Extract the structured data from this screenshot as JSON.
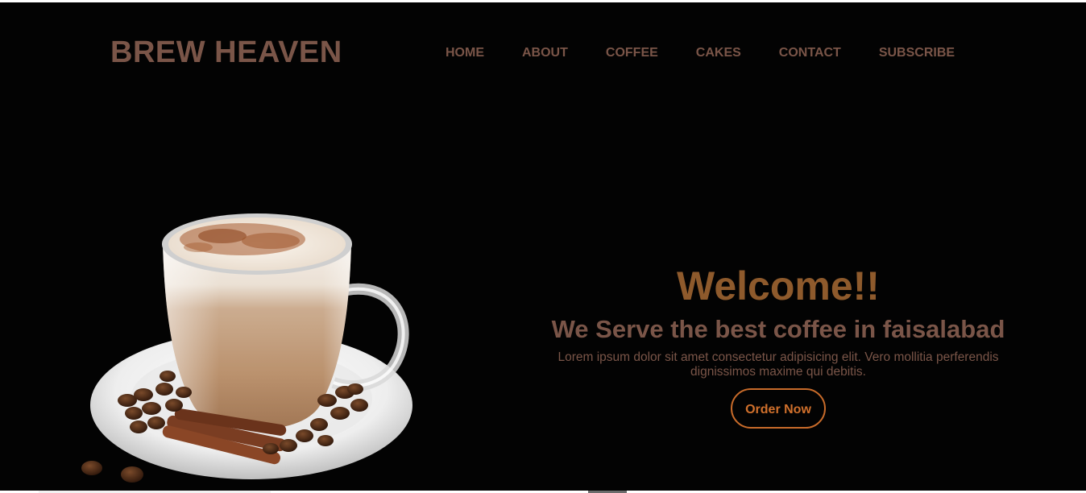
{
  "brand": {
    "name": "BREW HEAVEN"
  },
  "nav": {
    "items": [
      {
        "label": "HOME"
      },
      {
        "label": "ABOUT"
      },
      {
        "label": "COFFEE"
      },
      {
        "label": "CAKES"
      },
      {
        "label": "CONTACT"
      },
      {
        "label": "SUBSCRIBE"
      }
    ]
  },
  "hero": {
    "title": "Welcome!!",
    "subtitle": "We Serve the best coffee in faisalabad",
    "description": "Lorem ipsum dolor sit amet consectetur adipisicing elit. Vero mollitia perferendis dignissimos maxime qui debitis.",
    "cta_label": "Order Now",
    "image": "coffee-cup-with-beans-and-cinnamon"
  },
  "colors": {
    "background": "#030303",
    "brand_brown": "#7a5548",
    "title_brown": "#8e5a2c",
    "cta_orange": "#d0702c"
  }
}
